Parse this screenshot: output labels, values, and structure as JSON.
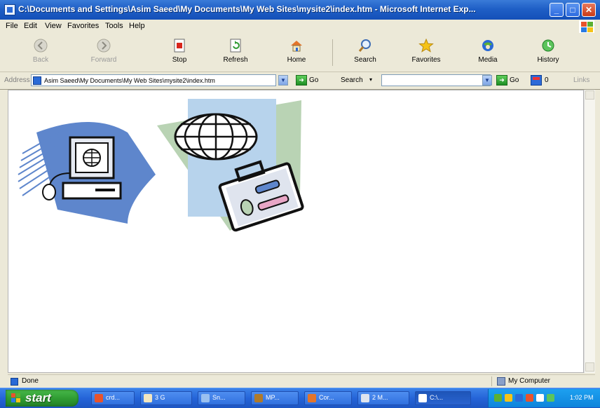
{
  "window": {
    "title": "C:\\Documents and Settings\\Asim Saeed\\My Documents\\My Web Sites\\mysite2\\index.htm - Microsoft Internet Exp...",
    "controls": {
      "minimize": "_",
      "maximize": "□",
      "close": "✕"
    }
  },
  "menu": {
    "items": [
      {
        "label": "File"
      },
      {
        "label": "Edit"
      },
      {
        "label": "View"
      },
      {
        "label": "Favorites"
      },
      {
        "label": "Tools"
      },
      {
        "label": "Help"
      }
    ]
  },
  "toolbar": {
    "buttons": [
      {
        "label": "Back",
        "icon": "back-arrow-icon",
        "enabled": false
      },
      {
        "label": "Forward",
        "icon": "forward-arrow-icon",
        "enabled": false
      },
      {
        "label": "Stop",
        "icon": "stop-icon",
        "enabled": true
      },
      {
        "label": "Refresh",
        "icon": "refresh-icon",
        "enabled": true
      },
      {
        "label": "Home",
        "icon": "home-icon",
        "enabled": true
      },
      {
        "label": "Search",
        "icon": "search-icon",
        "enabled": true
      },
      {
        "label": "Favorites",
        "icon": "star-icon",
        "enabled": true
      },
      {
        "label": "Media",
        "icon": "media-icon",
        "enabled": true
      },
      {
        "label": "History",
        "icon": "history-icon",
        "enabled": true
      }
    ]
  },
  "address": {
    "label": "Address",
    "value": "Asim Saeed\\My Documents\\My Web Sites\\mysite2\\index.htm",
    "go_label": "Go",
    "search_label": "Search",
    "search_value": "",
    "search_go_label": "Go",
    "extra_label": "0",
    "links_label": "Links"
  },
  "status": {
    "text": "Done",
    "zone": "My Computer"
  },
  "taskbar": {
    "start_label": "start",
    "tasks": [
      {
        "label": "crd..."
      },
      {
        "label": "3 G"
      },
      {
        "label": "Sn..."
      },
      {
        "label": "MP..."
      },
      {
        "label": "Cor..."
      },
      {
        "label": "2 M..."
      },
      {
        "label": "C:\\..."
      }
    ],
    "clock": "1:02 PM"
  },
  "colors": {
    "title_blue": "#1f5fc6",
    "taskbar_blue": "#2564d8",
    "start_green": "#2e9a31",
    "clipart_blue": "#5e86cc",
    "clipart_light_blue": "#b7d3ec",
    "clipart_green": "#b9d3b4"
  }
}
